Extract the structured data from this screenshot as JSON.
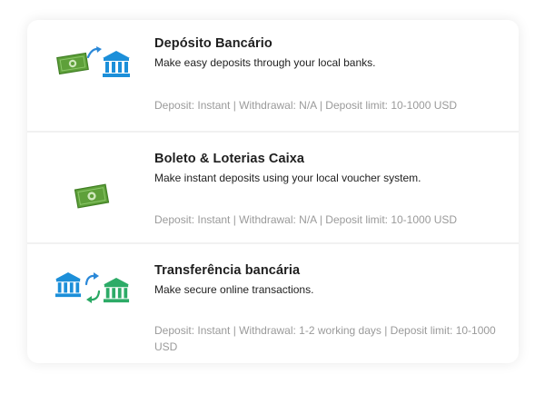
{
  "colors": {
    "money_green": "#5ea03a",
    "money_green_dark": "#3f7e23",
    "bank_blue": "#1c8fd9",
    "bank_green": "#2dab67",
    "arrow_blue": "#2a88d8",
    "arrow_green": "#29a863"
  },
  "methods": [
    {
      "name": "Depósito Bancário",
      "description": "Make easy deposits through your local banks.",
      "info": "Deposit: Instant | Withdrawal: N/A | Deposit limit: 10-1000 USD",
      "icon": "banknote-to-bank-icon"
    },
    {
      "name": "Boleto & Loterias Caixa",
      "description": "Make instant deposits using your local voucher system.",
      "info": "Deposit: Instant | Withdrawal: N/A | Deposit limit: 10-1000 USD",
      "icon": "banknote-icon"
    },
    {
      "name": "Transferência bancária",
      "description": "Make secure online transactions.",
      "info": "Deposit: Instant | Withdrawal: 1-2 working days | Deposit limit: 10-1000 USD",
      "icon": "bank-transfer-icon"
    }
  ]
}
